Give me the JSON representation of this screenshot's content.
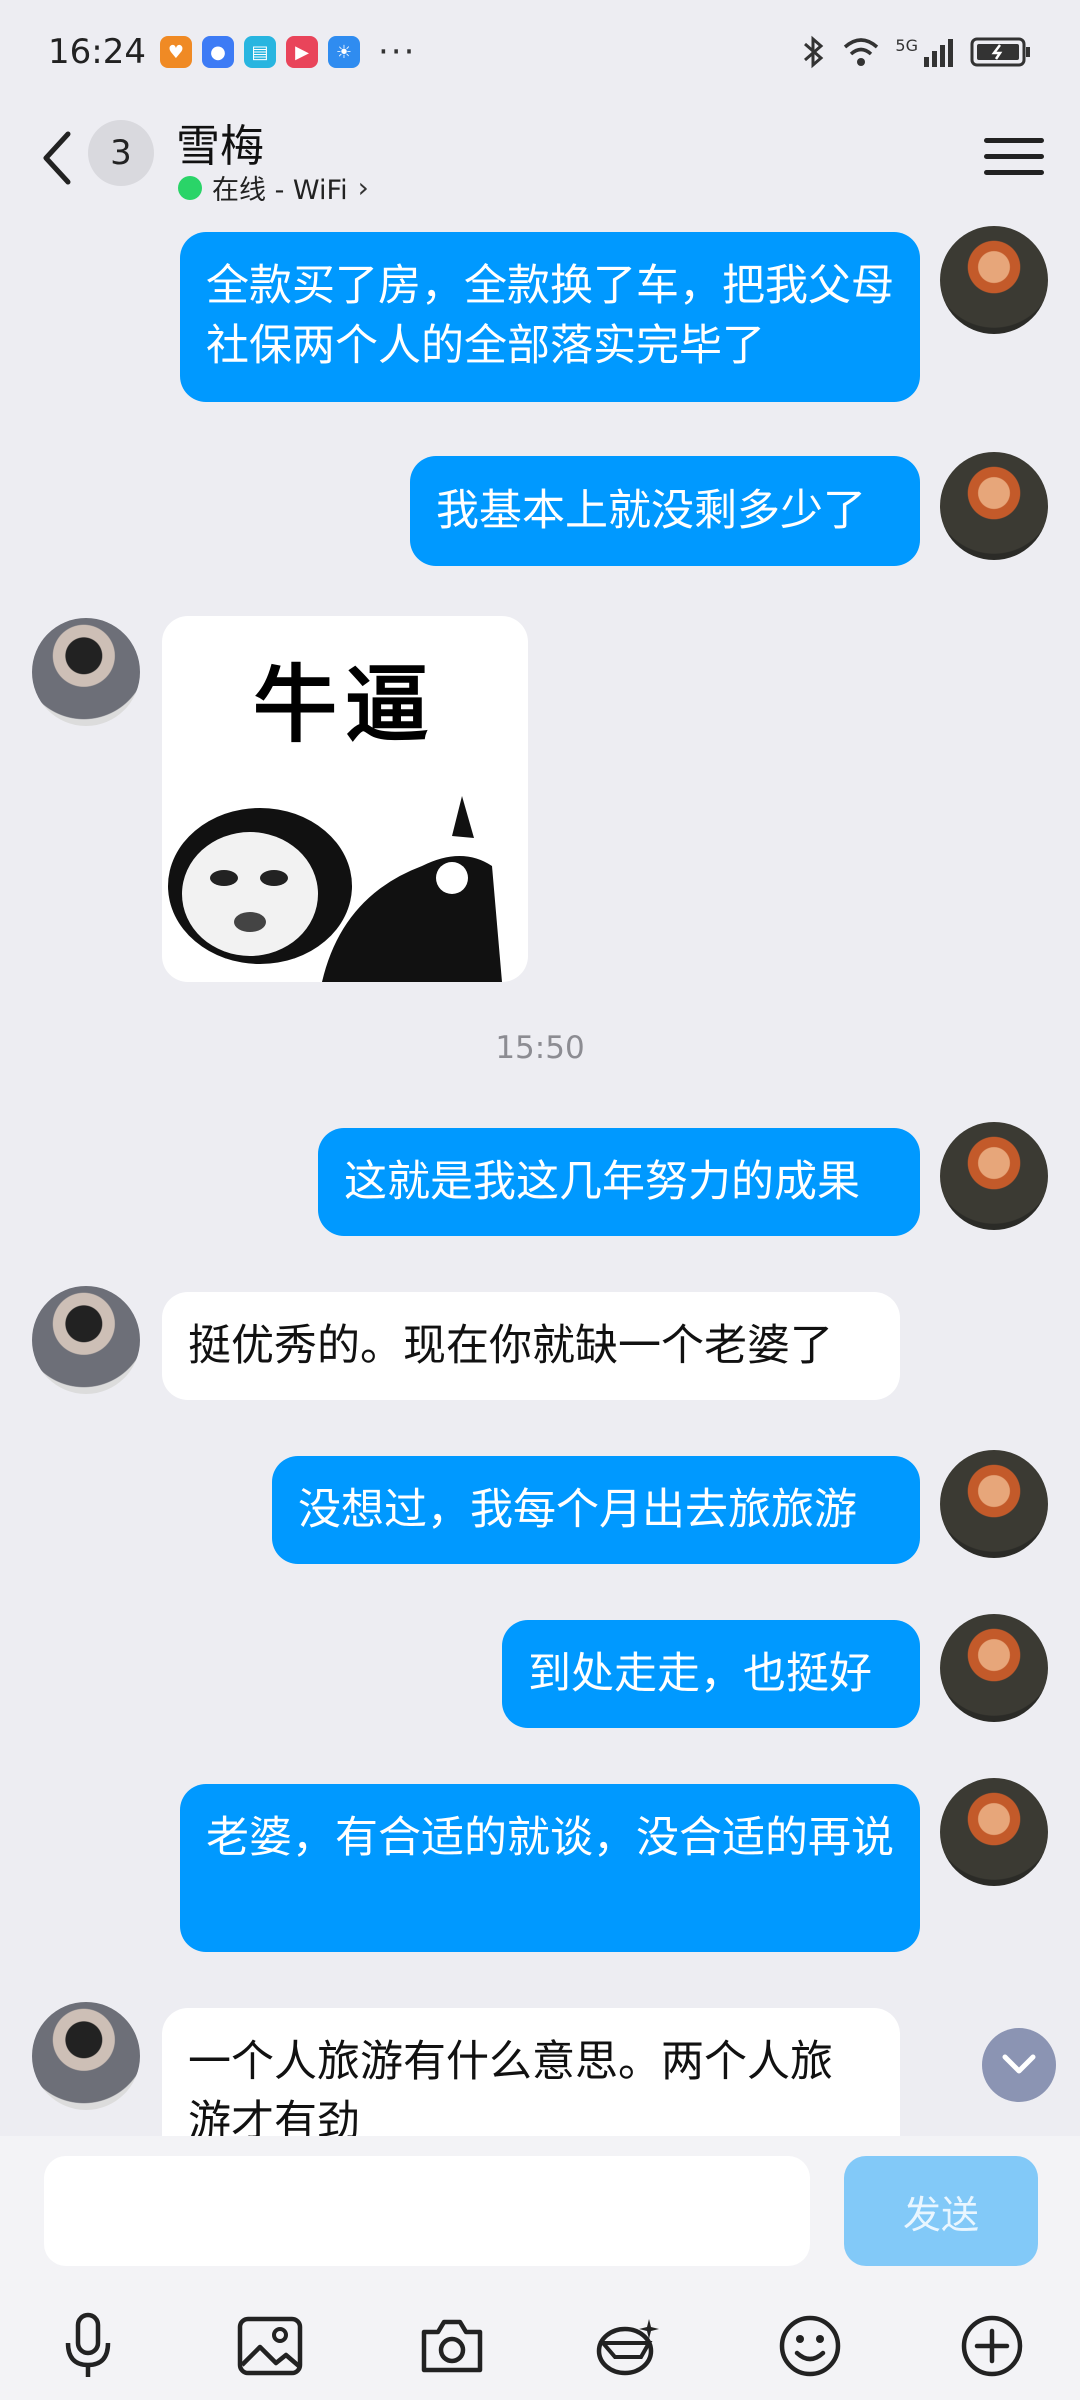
{
  "status_bar": {
    "time": "16:24",
    "more": "···",
    "network": "5G"
  },
  "header": {
    "back_icon": "chevron-left-icon",
    "unread_count": "3",
    "contact_name": "雪梅",
    "status_text": "在线 - WiFi",
    "status_chevron": "›",
    "status_color": "#2ad468"
  },
  "messages": [
    {
      "side": "me",
      "text": "全款买了房，全款换了车，把我父母社保两个人的全部落实完毕了"
    },
    {
      "side": "me",
      "text": "我基本上就没剩多少了"
    },
    {
      "side": "her",
      "type": "sticker",
      "sticker_text": "牛逼"
    },
    {
      "side": "me",
      "text": "这就是我这几年努力的成果"
    },
    {
      "side": "her",
      "text": "挺优秀的。现在你就缺一个老婆了"
    },
    {
      "side": "me",
      "text": "没想过，我每个月出去旅旅游"
    },
    {
      "side": "me",
      "text": "到处走走，也挺好"
    },
    {
      "side": "me",
      "text": "老婆，有合适的就谈，没合适的再说"
    },
    {
      "side": "her",
      "text": "一个人旅游有什么意思。两个人旅游才有劲"
    }
  ],
  "timestamp": "15:50",
  "input": {
    "placeholder": "",
    "send_label": "发送"
  },
  "colors": {
    "bubble_me": "#0099ff",
    "bubble_her": "#ffffff",
    "background": "#ededf2",
    "send_disabled": "#82c9f8"
  },
  "toolbar_icons": [
    "microphone-icon",
    "image-icon",
    "camera-icon",
    "sticker-icon",
    "emoji-icon",
    "plus-icon"
  ]
}
